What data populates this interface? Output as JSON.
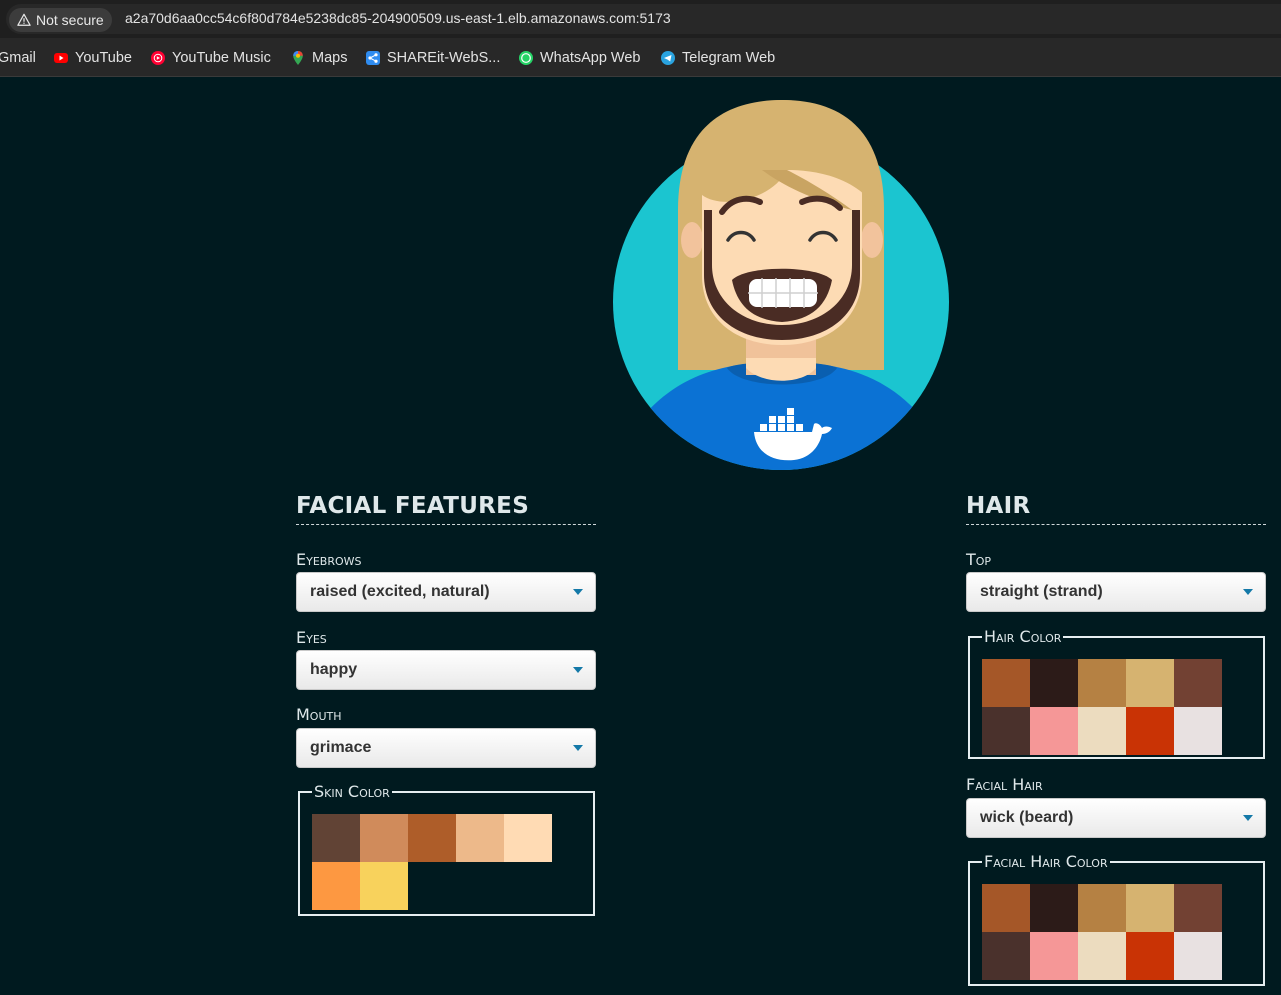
{
  "browser": {
    "security_label": "Not secure",
    "url": "a2a70d6aa0cc54c6f80d784e5238dc85-204900509.us-east-1.elb.amazonaws.com:5173",
    "bookmarks": [
      {
        "label": "Gmail",
        "icon": "gmail-icon"
      },
      {
        "label": "YouTube",
        "icon": "youtube-icon",
        "color": "#ff0000"
      },
      {
        "label": "YouTube Music",
        "icon": "youtube-music-icon",
        "color": "#ff0033"
      },
      {
        "label": "Maps",
        "icon": "maps-icon"
      },
      {
        "label": "SHAREit-WebS...",
        "icon": "shareit-icon",
        "color": "#2f8cf0"
      },
      {
        "label": "WhatsApp Web",
        "icon": "whatsapp-icon",
        "color": "#25d366"
      },
      {
        "label": "Telegram Web",
        "icon": "telegram-icon",
        "color": "#2aa3df"
      }
    ]
  },
  "avatar": {
    "background_color": "#1bc5d0",
    "shirt_color": "#0b72d4",
    "skin_color": "#fddbb4",
    "hair_color": "#d6b370",
    "beard_color": "#4a2c24",
    "shirt_graphic": "docker-whale-icon"
  },
  "facial_features": {
    "title": "FACIAL FEATURES",
    "eyebrows": {
      "label": "Eyebrows",
      "value": "raised (excited, natural)"
    },
    "eyes": {
      "label": "Eyes",
      "value": "happy"
    },
    "mouth": {
      "label": "Mouth",
      "value": "grimace"
    },
    "skin_color": {
      "legend": "Skin Color",
      "colors": [
        "#614335",
        "#d08b5b",
        "#ae5d29",
        "#edb98a",
        "#ffdbb4",
        "#fd9841",
        "#f8d25c"
      ]
    }
  },
  "hair": {
    "title": "HAIR",
    "top": {
      "label": "Top",
      "value": "straight (strand)"
    },
    "hair_color": {
      "legend": "Hair Color",
      "colors": [
        "#a55728",
        "#2c1b18",
        "#b58143",
        "#d6b370",
        "#724133",
        "#4a312c",
        "#f59797",
        "#ecdcbf",
        "#c93305",
        "#e8e1e1"
      ]
    },
    "facial_hair": {
      "label": "Facial Hair",
      "value": "wick (beard)"
    },
    "facial_hair_color": {
      "legend": "Facial Hair Color",
      "colors": [
        "#a55728",
        "#2c1b18",
        "#b58143",
        "#d6b370",
        "#724133",
        "#4a312c",
        "#f59797",
        "#ecdcbf",
        "#c93305",
        "#e8e1e1"
      ]
    }
  }
}
